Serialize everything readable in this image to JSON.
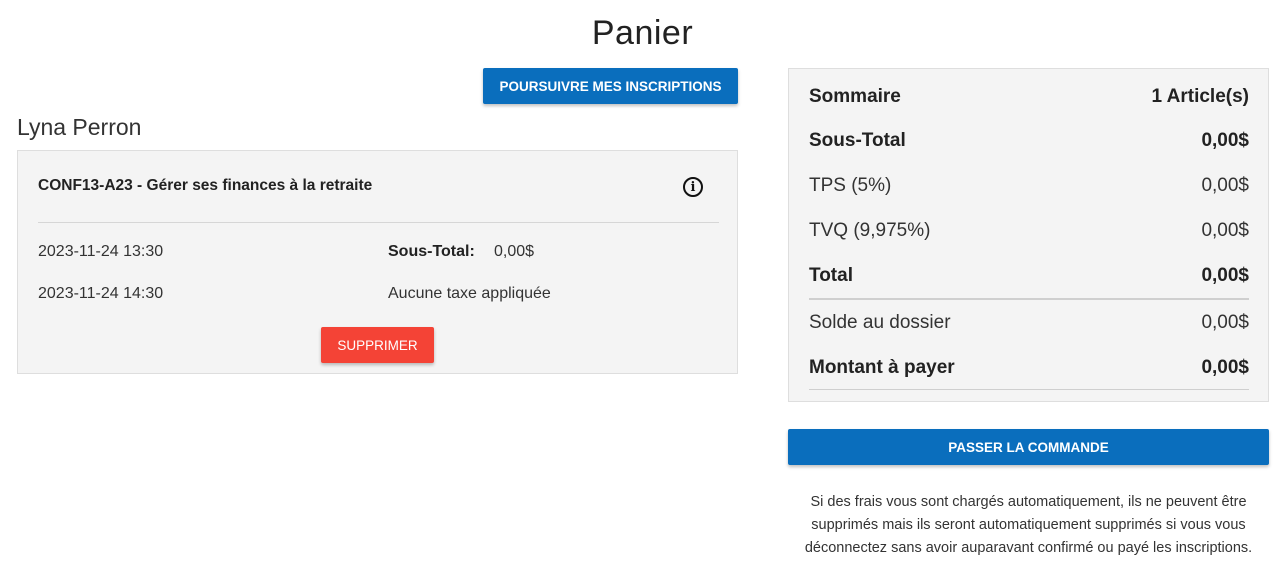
{
  "page": {
    "title": "Panier"
  },
  "actions": {
    "continue_label": "POURSUIVRE MES INSCRIPTIONS",
    "order_label": "PASSER LA COMMANDE"
  },
  "student": {
    "name": "Lyna Perron"
  },
  "cart_item": {
    "title": "CONF13-A23 - Gérer ses finances à la retraite",
    "info_icon": "info-icon",
    "start": "2023-11-24 13:30",
    "end": "2023-11-24 14:30",
    "subtotal_label": "Sous-Total:",
    "subtotal_value": "0,00$",
    "tax_note": "Aucune taxe appliquée",
    "delete_label": "SUPPRIMER"
  },
  "summary": {
    "header_label": "Sommaire",
    "header_count": "1 Article(s)",
    "subtotal_label": "Sous-Total",
    "subtotal_value": "0,00$",
    "tps_label": "TPS (5%)",
    "tps_value": "0,00$",
    "tvq_label": "TVQ (9,975%)",
    "tvq_value": "0,00$",
    "total_label": "Total",
    "total_value": "0,00$",
    "balance_label": "Solde au dossier",
    "balance_value": "0,00$",
    "due_label": "Montant à payer",
    "due_value": "0,00$"
  },
  "disclaimer": "Si des frais vous sont chargés automatiquement, ils ne peuvent être supprimés mais ils seront automatiquement supprimés si vous vous déconnectez sans avoir auparavant confirmé ou payé les inscriptions.",
  "colors": {
    "primary": "#0a6ebd",
    "danger": "#f44336"
  }
}
